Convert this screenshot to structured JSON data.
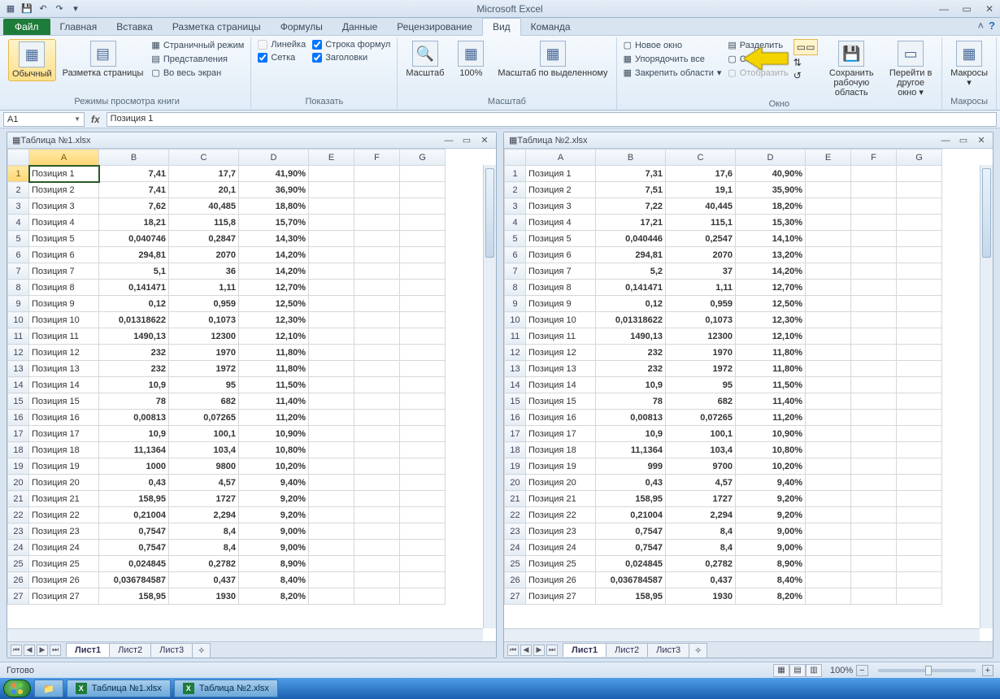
{
  "app_title": "Microsoft Excel",
  "qat": [
    "save-icon",
    "undo-icon",
    "redo-icon"
  ],
  "win_buttons": [
    "min",
    "restore",
    "close"
  ],
  "ribbon": {
    "file_tab": "Файл",
    "tabs": [
      "Главная",
      "Вставка",
      "Разметка страницы",
      "Формулы",
      "Данные",
      "Рецензирование",
      "Вид",
      "Команда"
    ],
    "active_tab": "Вид",
    "groups": {
      "views": {
        "label": "Режимы просмотра книги",
        "normal": "Обычный",
        "layout": "Разметка страницы",
        "page_break": "Страничный режим",
        "custom_views": "Представления",
        "fullscreen": "Во весь экран"
      },
      "show": {
        "label": "Показать",
        "ruler": "Линейка",
        "gridlines": "Сетка",
        "formula_bar": "Строка формул",
        "headings": "Заголовки"
      },
      "zoom": {
        "label": "Масштаб",
        "zoom": "Масштаб",
        "pct100": "100%",
        "to_selection": "Масштаб по выделенному"
      },
      "window": {
        "label": "Окно",
        "new_window": "Новое окно",
        "arrange": "Упорядочить все",
        "freeze": "Закрепить области",
        "split": "Разделить",
        "hide": "Скрыть",
        "unhide": "Отобразить",
        "save_workspace": "Сохранить рабочую область",
        "switch": "Перейти в другое окно"
      },
      "macros": {
        "label": "Макросы",
        "macros": "Макросы"
      }
    }
  },
  "namebox": "A1",
  "formula": "Позиция 1",
  "windows": [
    {
      "title": "Таблица №1.xlsx",
      "columns": [
        "A",
        "B",
        "C",
        "D",
        "E",
        "F",
        "G"
      ],
      "sheets": [
        "Лист1",
        "Лист2",
        "Лист3"
      ],
      "active_sheet": "Лист1",
      "rows": [
        {
          "n": 1,
          "a": "Позиция 1",
          "b": "7,41",
          "c": "17,7",
          "d": "41,90%"
        },
        {
          "n": 2,
          "a": "Позиция 2",
          "b": "7,41",
          "c": "20,1",
          "d": "36,90%"
        },
        {
          "n": 3,
          "a": "Позиция 3",
          "b": "7,62",
          "c": "40,485",
          "d": "18,80%"
        },
        {
          "n": 4,
          "a": "Позиция 4",
          "b": "18,21",
          "c": "115,8",
          "d": "15,70%"
        },
        {
          "n": 5,
          "a": "Позиция 5",
          "b": "0,040746",
          "c": "0,2847",
          "d": "14,30%"
        },
        {
          "n": 6,
          "a": "Позиция 6",
          "b": "294,81",
          "c": "2070",
          "d": "14,20%"
        },
        {
          "n": 7,
          "a": "Позиция 7",
          "b": "5,1",
          "c": "36",
          "d": "14,20%"
        },
        {
          "n": 8,
          "a": "Позиция 8",
          "b": "0,141471",
          "c": "1,11",
          "d": "12,70%"
        },
        {
          "n": 9,
          "a": "Позиция 9",
          "b": "0,12",
          "c": "0,959",
          "d": "12,50%"
        },
        {
          "n": 10,
          "a": "Позиция 10",
          "b": "0,01318622",
          "c": "0,1073",
          "d": "12,30%"
        },
        {
          "n": 11,
          "a": "Позиция 11",
          "b": "1490,13",
          "c": "12300",
          "d": "12,10%"
        },
        {
          "n": 12,
          "a": "Позиция 12",
          "b": "232",
          "c": "1970",
          "d": "11,80%"
        },
        {
          "n": 13,
          "a": "Позиция 13",
          "b": "232",
          "c": "1972",
          "d": "11,80%"
        },
        {
          "n": 14,
          "a": "Позиция 14",
          "b": "10,9",
          "c": "95",
          "d": "11,50%"
        },
        {
          "n": 15,
          "a": "Позиция 15",
          "b": "78",
          "c": "682",
          "d": "11,40%"
        },
        {
          "n": 16,
          "a": "Позиция 16",
          "b": "0,00813",
          "c": "0,07265",
          "d": "11,20%"
        },
        {
          "n": 17,
          "a": "Позиция 17",
          "b": "10,9",
          "c": "100,1",
          "d": "10,90%"
        },
        {
          "n": 18,
          "a": "Позиция 18",
          "b": "11,1364",
          "c": "103,4",
          "d": "10,80%"
        },
        {
          "n": 19,
          "a": "Позиция 19",
          "b": "1000",
          "c": "9800",
          "d": "10,20%"
        },
        {
          "n": 20,
          "a": "Позиция 20",
          "b": "0,43",
          "c": "4,57",
          "d": "9,40%"
        },
        {
          "n": 21,
          "a": "Позиция 21",
          "b": "158,95",
          "c": "1727",
          "d": "9,20%"
        },
        {
          "n": 22,
          "a": "Позиция 22",
          "b": "0,21004",
          "c": "2,294",
          "d": "9,20%"
        },
        {
          "n": 23,
          "a": "Позиция 23",
          "b": "0,7547",
          "c": "8,4",
          "d": "9,00%"
        },
        {
          "n": 24,
          "a": "Позиция 24",
          "b": "0,7547",
          "c": "8,4",
          "d": "9,00%"
        },
        {
          "n": 25,
          "a": "Позиция 25",
          "b": "0,024845",
          "c": "0,2782",
          "d": "8,90%"
        },
        {
          "n": 26,
          "a": "Позиция 26",
          "b": "0,036784587",
          "c": "0,437",
          "d": "8,40%"
        },
        {
          "n": 27,
          "a": "Позиция 27",
          "b": "158,95",
          "c": "1930",
          "d": "8,20%"
        }
      ]
    },
    {
      "title": "Таблица №2.xlsx",
      "columns": [
        "A",
        "B",
        "C",
        "D",
        "E",
        "F",
        "G"
      ],
      "sheets": [
        "Лист1",
        "Лист2",
        "Лист3"
      ],
      "active_sheet": "Лист1",
      "rows": [
        {
          "n": 1,
          "a": "Позиция 1",
          "b": "7,31",
          "c": "17,6",
          "d": "40,90%"
        },
        {
          "n": 2,
          "a": "Позиция 2",
          "b": "7,51",
          "c": "19,1",
          "d": "35,90%"
        },
        {
          "n": 3,
          "a": "Позиция 3",
          "b": "7,22",
          "c": "40,445",
          "d": "18,20%"
        },
        {
          "n": 4,
          "a": "Позиция 4",
          "b": "17,21",
          "c": "115,1",
          "d": "15,30%"
        },
        {
          "n": 5,
          "a": "Позиция 5",
          "b": "0,040446",
          "c": "0,2547",
          "d": "14,10%"
        },
        {
          "n": 6,
          "a": "Позиция 6",
          "b": "294,81",
          "c": "2070",
          "d": "13,20%"
        },
        {
          "n": 7,
          "a": "Позиция 7",
          "b": "5,2",
          "c": "37",
          "d": "14,20%"
        },
        {
          "n": 8,
          "a": "Позиция 8",
          "b": "0,141471",
          "c": "1,11",
          "d": "12,70%"
        },
        {
          "n": 9,
          "a": "Позиция 9",
          "b": "0,12",
          "c": "0,959",
          "d": "12,50%"
        },
        {
          "n": 10,
          "a": "Позиция 10",
          "b": "0,01318622",
          "c": "0,1073",
          "d": "12,30%"
        },
        {
          "n": 11,
          "a": "Позиция 11",
          "b": "1490,13",
          "c": "12300",
          "d": "12,10%"
        },
        {
          "n": 12,
          "a": "Позиция 12",
          "b": "232",
          "c": "1970",
          "d": "11,80%"
        },
        {
          "n": 13,
          "a": "Позиция 13",
          "b": "232",
          "c": "1972",
          "d": "11,80%"
        },
        {
          "n": 14,
          "a": "Позиция 14",
          "b": "10,9",
          "c": "95",
          "d": "11,50%"
        },
        {
          "n": 15,
          "a": "Позиция 15",
          "b": "78",
          "c": "682",
          "d": "11,40%"
        },
        {
          "n": 16,
          "a": "Позиция 16",
          "b": "0,00813",
          "c": "0,07265",
          "d": "11,20%"
        },
        {
          "n": 17,
          "a": "Позиция 17",
          "b": "10,9",
          "c": "100,1",
          "d": "10,90%"
        },
        {
          "n": 18,
          "a": "Позиция 18",
          "b": "11,1364",
          "c": "103,4",
          "d": "10,80%"
        },
        {
          "n": 19,
          "a": "Позиция 19",
          "b": "999",
          "c": "9700",
          "d": "10,20%"
        },
        {
          "n": 20,
          "a": "Позиция 20",
          "b": "0,43",
          "c": "4,57",
          "d": "9,40%"
        },
        {
          "n": 21,
          "a": "Позиция 21",
          "b": "158,95",
          "c": "1727",
          "d": "9,20%"
        },
        {
          "n": 22,
          "a": "Позиция 22",
          "b": "0,21004",
          "c": "2,294",
          "d": "9,20%"
        },
        {
          "n": 23,
          "a": "Позиция 23",
          "b": "0,7547",
          "c": "8,4",
          "d": "9,00%"
        },
        {
          "n": 24,
          "a": "Позиция 24",
          "b": "0,7547",
          "c": "8,4",
          "d": "9,00%"
        },
        {
          "n": 25,
          "a": "Позиция 25",
          "b": "0,024845",
          "c": "0,2782",
          "d": "8,90%"
        },
        {
          "n": 26,
          "a": "Позиция 26",
          "b": "0,036784587",
          "c": "0,437",
          "d": "8,40%"
        },
        {
          "n": 27,
          "a": "Позиция 27",
          "b": "158,95",
          "c": "1930",
          "d": "8,20%"
        }
      ]
    }
  ],
  "status": {
    "ready": "Готово",
    "zoom": "100%"
  },
  "taskbar": {
    "items": [
      "Таблица №1.xlsx",
      "Таблица №2.xlsx"
    ]
  }
}
